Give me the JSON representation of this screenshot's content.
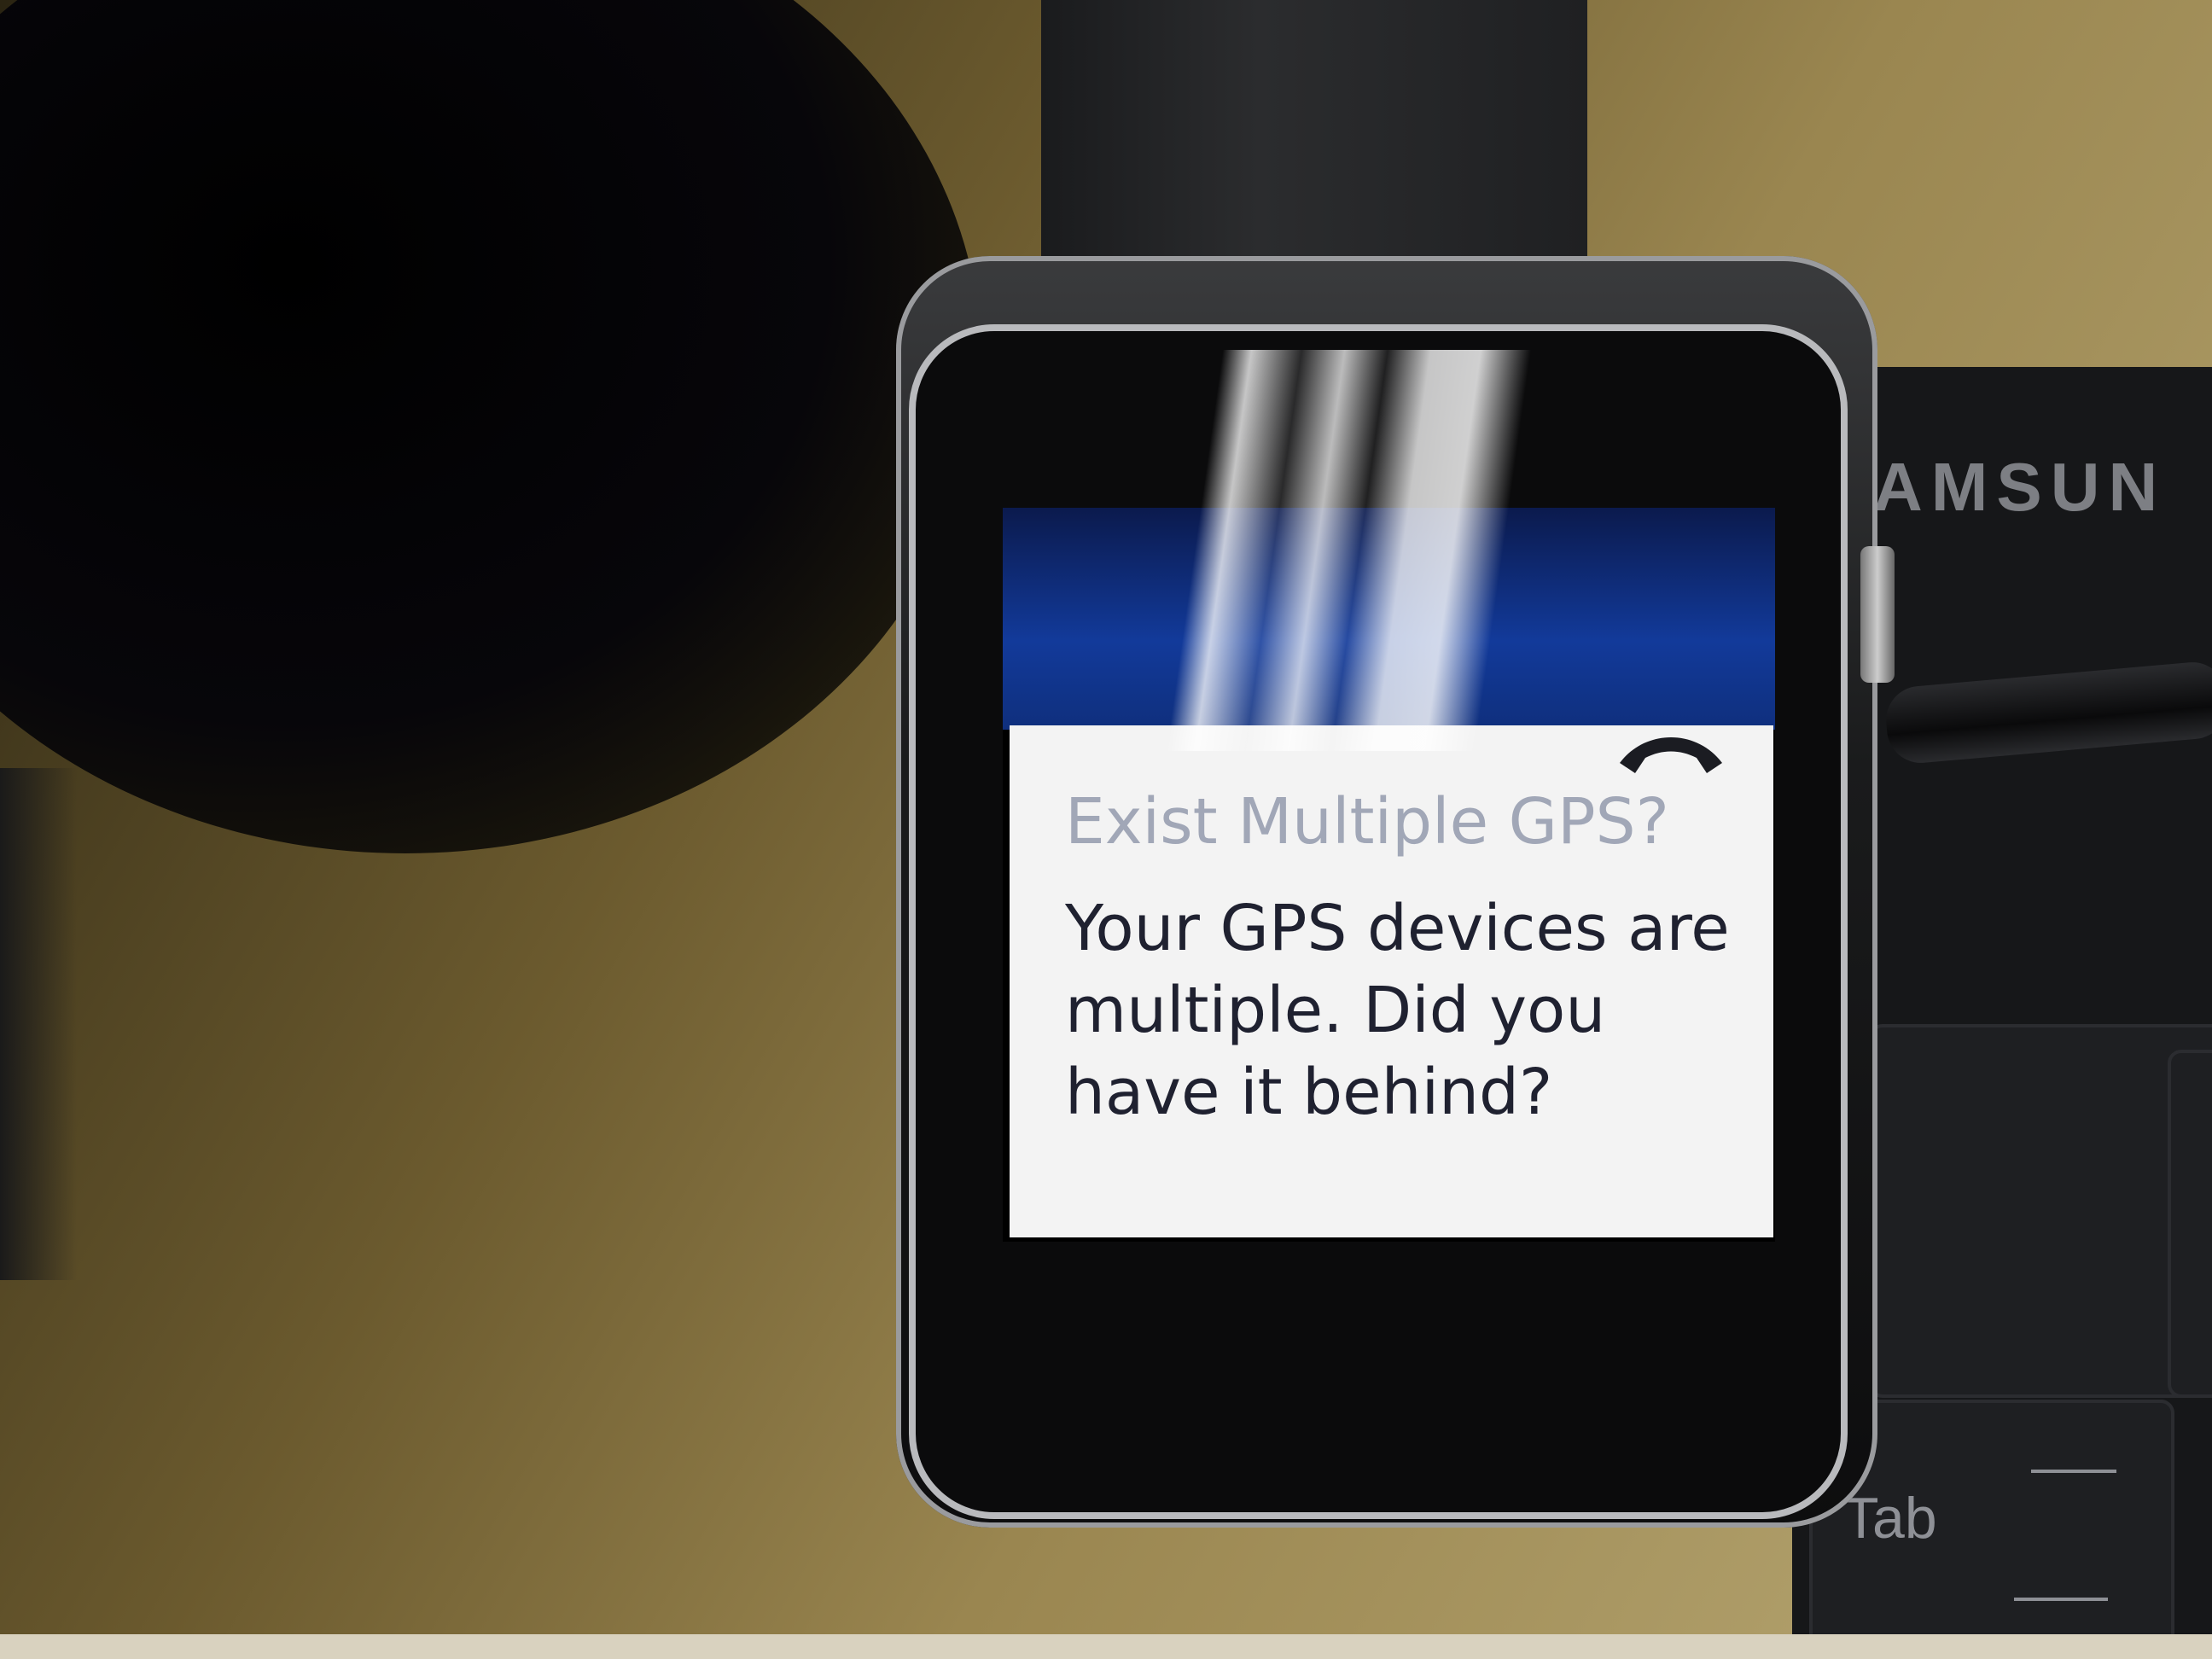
{
  "background": {
    "keyboard": {
      "brand": "AMSUN",
      "tab_label": "Tab"
    }
  },
  "watch": {
    "notification": {
      "icon": "end-call-icon",
      "title": "Exist Multiple GPS?",
      "body": "Your GPS devices are multiple. Did you have it behind?"
    }
  },
  "colors": {
    "card_background": "#f3f3f3",
    "title_text": "#a1a7b7",
    "body_text": "#1f2130",
    "screen_top": "#123a9a"
  }
}
